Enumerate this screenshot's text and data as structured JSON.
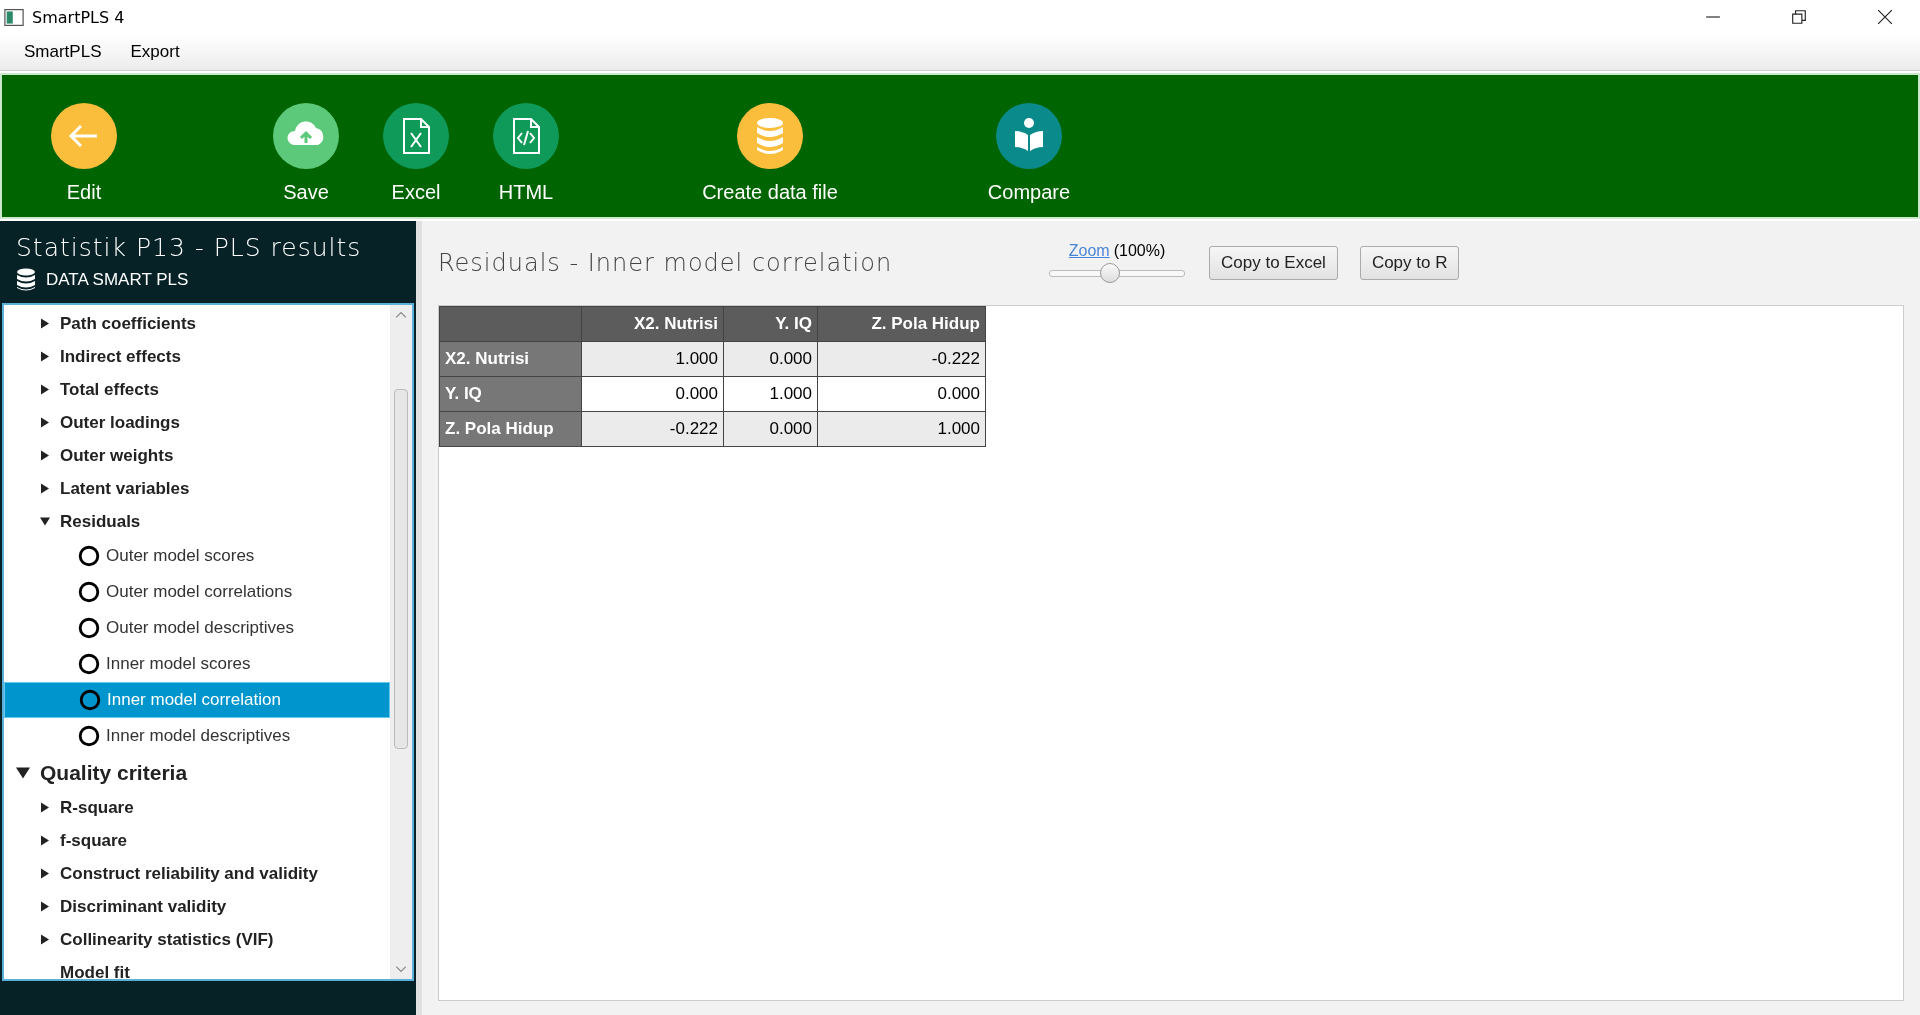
{
  "window": {
    "title": "SmartPLS 4"
  },
  "menu": [
    "SmartPLS",
    "Export"
  ],
  "toolbar": [
    {
      "label": "Edit",
      "kind": "back",
      "color": "#fbbd3c"
    },
    {
      "label": "Save",
      "kind": "cloud",
      "color": "#5cc97a"
    },
    {
      "label": "Excel",
      "kind": "excel",
      "color": "#0f9a5a"
    },
    {
      "label": "HTML",
      "kind": "html",
      "color": "#0f9a5a"
    },
    {
      "label": "Create data file",
      "kind": "database",
      "color": "#fbbd3c"
    },
    {
      "label": "Compare",
      "kind": "book",
      "color": "#0a8a8a"
    }
  ],
  "sidebar": {
    "title": "Statistik P13 - PLS results",
    "dataset": "DATA SMART PLS",
    "tree": [
      {
        "kind": "continued",
        "children": [
          {
            "kind": "branch",
            "label": "Path coefficients",
            "expanded": false
          },
          {
            "kind": "branch",
            "label": "Indirect effects",
            "expanded": false
          },
          {
            "kind": "branch",
            "label": "Total effects",
            "expanded": false
          },
          {
            "kind": "branch",
            "label": "Outer loadings",
            "expanded": false
          },
          {
            "kind": "branch",
            "label": "Outer weights",
            "expanded": false
          },
          {
            "kind": "branch",
            "label": "Latent variables",
            "expanded": false
          },
          {
            "kind": "branch",
            "label": "Residuals",
            "expanded": true,
            "children": [
              {
                "kind": "option",
                "label": "Outer model scores",
                "selected": false
              },
              {
                "kind": "option",
                "label": "Outer model correlations",
                "selected": false
              },
              {
                "kind": "option",
                "label": "Outer model descriptives",
                "selected": false
              },
              {
                "kind": "option",
                "label": "Inner model scores",
                "selected": false
              },
              {
                "kind": "option",
                "label": "Inner model correlation",
                "selected": true
              },
              {
                "kind": "option",
                "label": "Inner model descriptives",
                "selected": false
              }
            ]
          }
        ]
      },
      {
        "kind": "branch",
        "label": "Quality criteria",
        "expanded": true,
        "children": [
          {
            "kind": "branch",
            "label": "R-square",
            "expanded": false
          },
          {
            "kind": "branch",
            "label": "f-square",
            "expanded": false
          },
          {
            "kind": "branch",
            "label": "Construct reliability and validity",
            "expanded": false
          },
          {
            "kind": "branch",
            "label": "Discriminant validity",
            "expanded": false
          },
          {
            "kind": "branch",
            "label": "Collinearity statistics (VIF)",
            "expanded": false
          },
          {
            "kind": "plain",
            "label": "Model fit"
          }
        ]
      }
    ]
  },
  "content": {
    "title": "Residuals - Inner model correlation",
    "zoom_link": "Zoom",
    "zoom_value": "(100%)",
    "zoom_slider": {
      "level": 0.45
    },
    "buttons": [
      "Copy to Excel",
      "Copy to R"
    ],
    "table": {
      "columns": [
        "X2. Nutrisi",
        "Y. IQ",
        "Z. Pola Hidup"
      ],
      "rows": [
        {
          "header": "X2. Nutrisi",
          "cells": [
            "1.000",
            "0.000",
            "-0.222"
          ]
        },
        {
          "header": "Y. IQ",
          "cells": [
            "0.000",
            "1.000",
            "0.000"
          ]
        },
        {
          "header": "Z. Pola Hidup",
          "cells": [
            "-0.222",
            "0.000",
            "1.000"
          ]
        }
      ]
    }
  }
}
